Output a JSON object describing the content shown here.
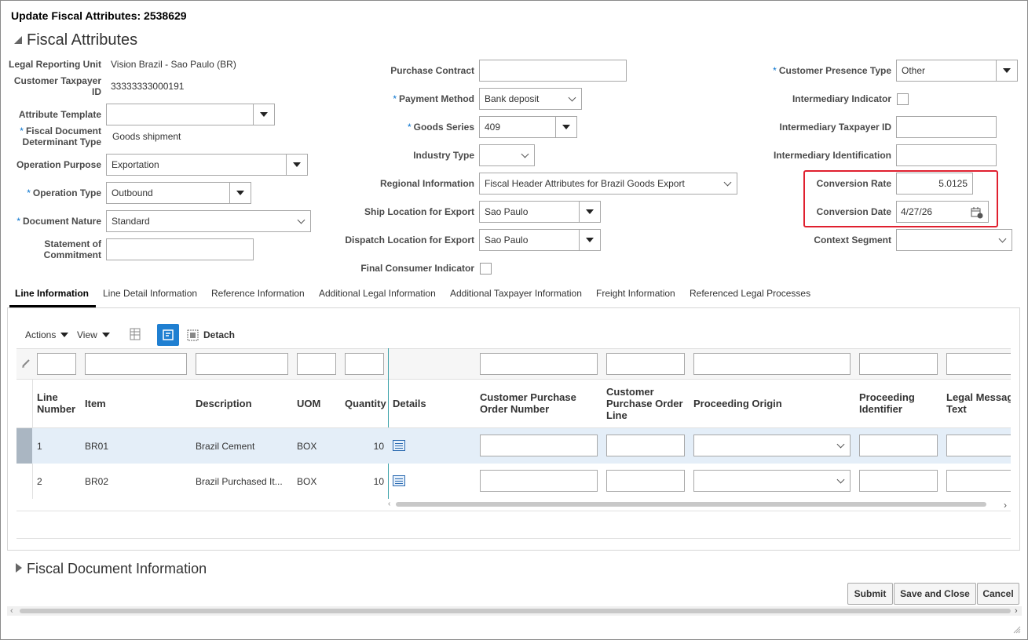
{
  "dialog": {
    "title": "Update Fiscal Attributes: 2538629"
  },
  "fiscal_attributes": {
    "section_title": "Fiscal Attributes",
    "left": {
      "legal_reporting_unit": {
        "label": "Legal Reporting Unit",
        "value": "Vision Brazil - Sao Paulo (BR)"
      },
      "customer_taxpayer_id": {
        "label1": "Customer Taxpayer",
        "label2": "ID",
        "value": "33333333000191"
      },
      "attribute_template": {
        "label": "Attribute Template",
        "value": ""
      },
      "fiscal_document_determinant_type": {
        "label1": "Fiscal Document",
        "label2": "Determinant Type",
        "value": "Goods shipment"
      },
      "operation_purpose": {
        "label": "Operation Purpose",
        "value": "Exportation"
      },
      "operation_type": {
        "label": "Operation Type",
        "value": "Outbound"
      },
      "document_nature": {
        "label": "Document Nature",
        "value": "Standard"
      },
      "statement_of_commitment": {
        "label1": "Statement of",
        "label2": "Commitment",
        "value": ""
      }
    },
    "middle": {
      "purchase_contract": {
        "label": "Purchase Contract",
        "value": ""
      },
      "payment_method": {
        "label": "Payment Method",
        "value": "Bank deposit"
      },
      "goods_series": {
        "label": "Goods Series",
        "value": "409"
      },
      "industry_type": {
        "label": "Industry Type",
        "value": ""
      },
      "regional_information": {
        "label": "Regional Information",
        "value": "Fiscal Header Attributes for Brazil Goods Export"
      },
      "ship_location_for_export": {
        "label": "Ship Location for Export",
        "value": "Sao Paulo"
      },
      "dispatch_location_for_export": {
        "label": "Dispatch Location for Export",
        "value": "Sao Paulo"
      },
      "final_consumer_indicator": {
        "label": "Final Consumer Indicator",
        "checked": false
      }
    },
    "right": {
      "customer_presence_type": {
        "label": "Customer Presence Type",
        "value": "Other"
      },
      "intermediary_indicator": {
        "label": "Intermediary Indicator",
        "checked": false
      },
      "intermediary_taxpayer_id": {
        "label": "Intermediary Taxpayer ID",
        "value": ""
      },
      "intermediary_identification": {
        "label": "Intermediary Identification",
        "value": ""
      },
      "conversion_rate": {
        "label": "Conversion Rate",
        "value": "5.0125"
      },
      "conversion_date": {
        "label": "Conversion Date",
        "value": "4/27/26"
      },
      "context_segment": {
        "label": "Context Segment",
        "value": ""
      }
    },
    "required_marker": "*"
  },
  "tabs": [
    {
      "label": "Line Information",
      "active": true
    },
    {
      "label": "Line Detail Information"
    },
    {
      "label": "Reference Information"
    },
    {
      "label": "Additional Legal Information"
    },
    {
      "label": "Additional Taxpayer Information"
    },
    {
      "label": "Freight Information"
    },
    {
      "label": "Referenced Legal Processes"
    }
  ],
  "toolbar": {
    "actions": "Actions",
    "view": "View",
    "detach": "Detach"
  },
  "table": {
    "columns": {
      "line_number": [
        "Line",
        "Number"
      ],
      "item": "Item",
      "description": "Description",
      "uom": "UOM",
      "quantity": "Quantity",
      "details": "Details",
      "customer_po_number": [
        "Customer Purchase",
        "Order Number"
      ],
      "customer_po_line": [
        "Customer",
        "Purchase Order",
        "Line"
      ],
      "proceeding_origin": "Proceeding Origin",
      "proceeding_identifier": [
        "Proceeding",
        "Identifier"
      ],
      "legal_message_text": [
        "Legal Messag",
        "Text"
      ]
    },
    "rows": [
      {
        "line_number": "1",
        "item": "BR01",
        "description": "Brazil Cement",
        "uom": "BOX",
        "quantity": "10"
      },
      {
        "line_number": "2",
        "item": "BR02",
        "description": "Brazil Purchased It...",
        "uom": "BOX",
        "quantity": "10"
      }
    ]
  },
  "fiscal_document_information": {
    "section_title": "Fiscal Document Information"
  },
  "buttons": {
    "submit": "Submit",
    "save_and_close": "Save and Close",
    "cancel": "Cancel"
  },
  "colors": {
    "highlight_box": "#e0202f",
    "required_asterisk": "#0572ce",
    "selected_row": "#e4eef8",
    "icon_blue": "#1f7fd1"
  }
}
